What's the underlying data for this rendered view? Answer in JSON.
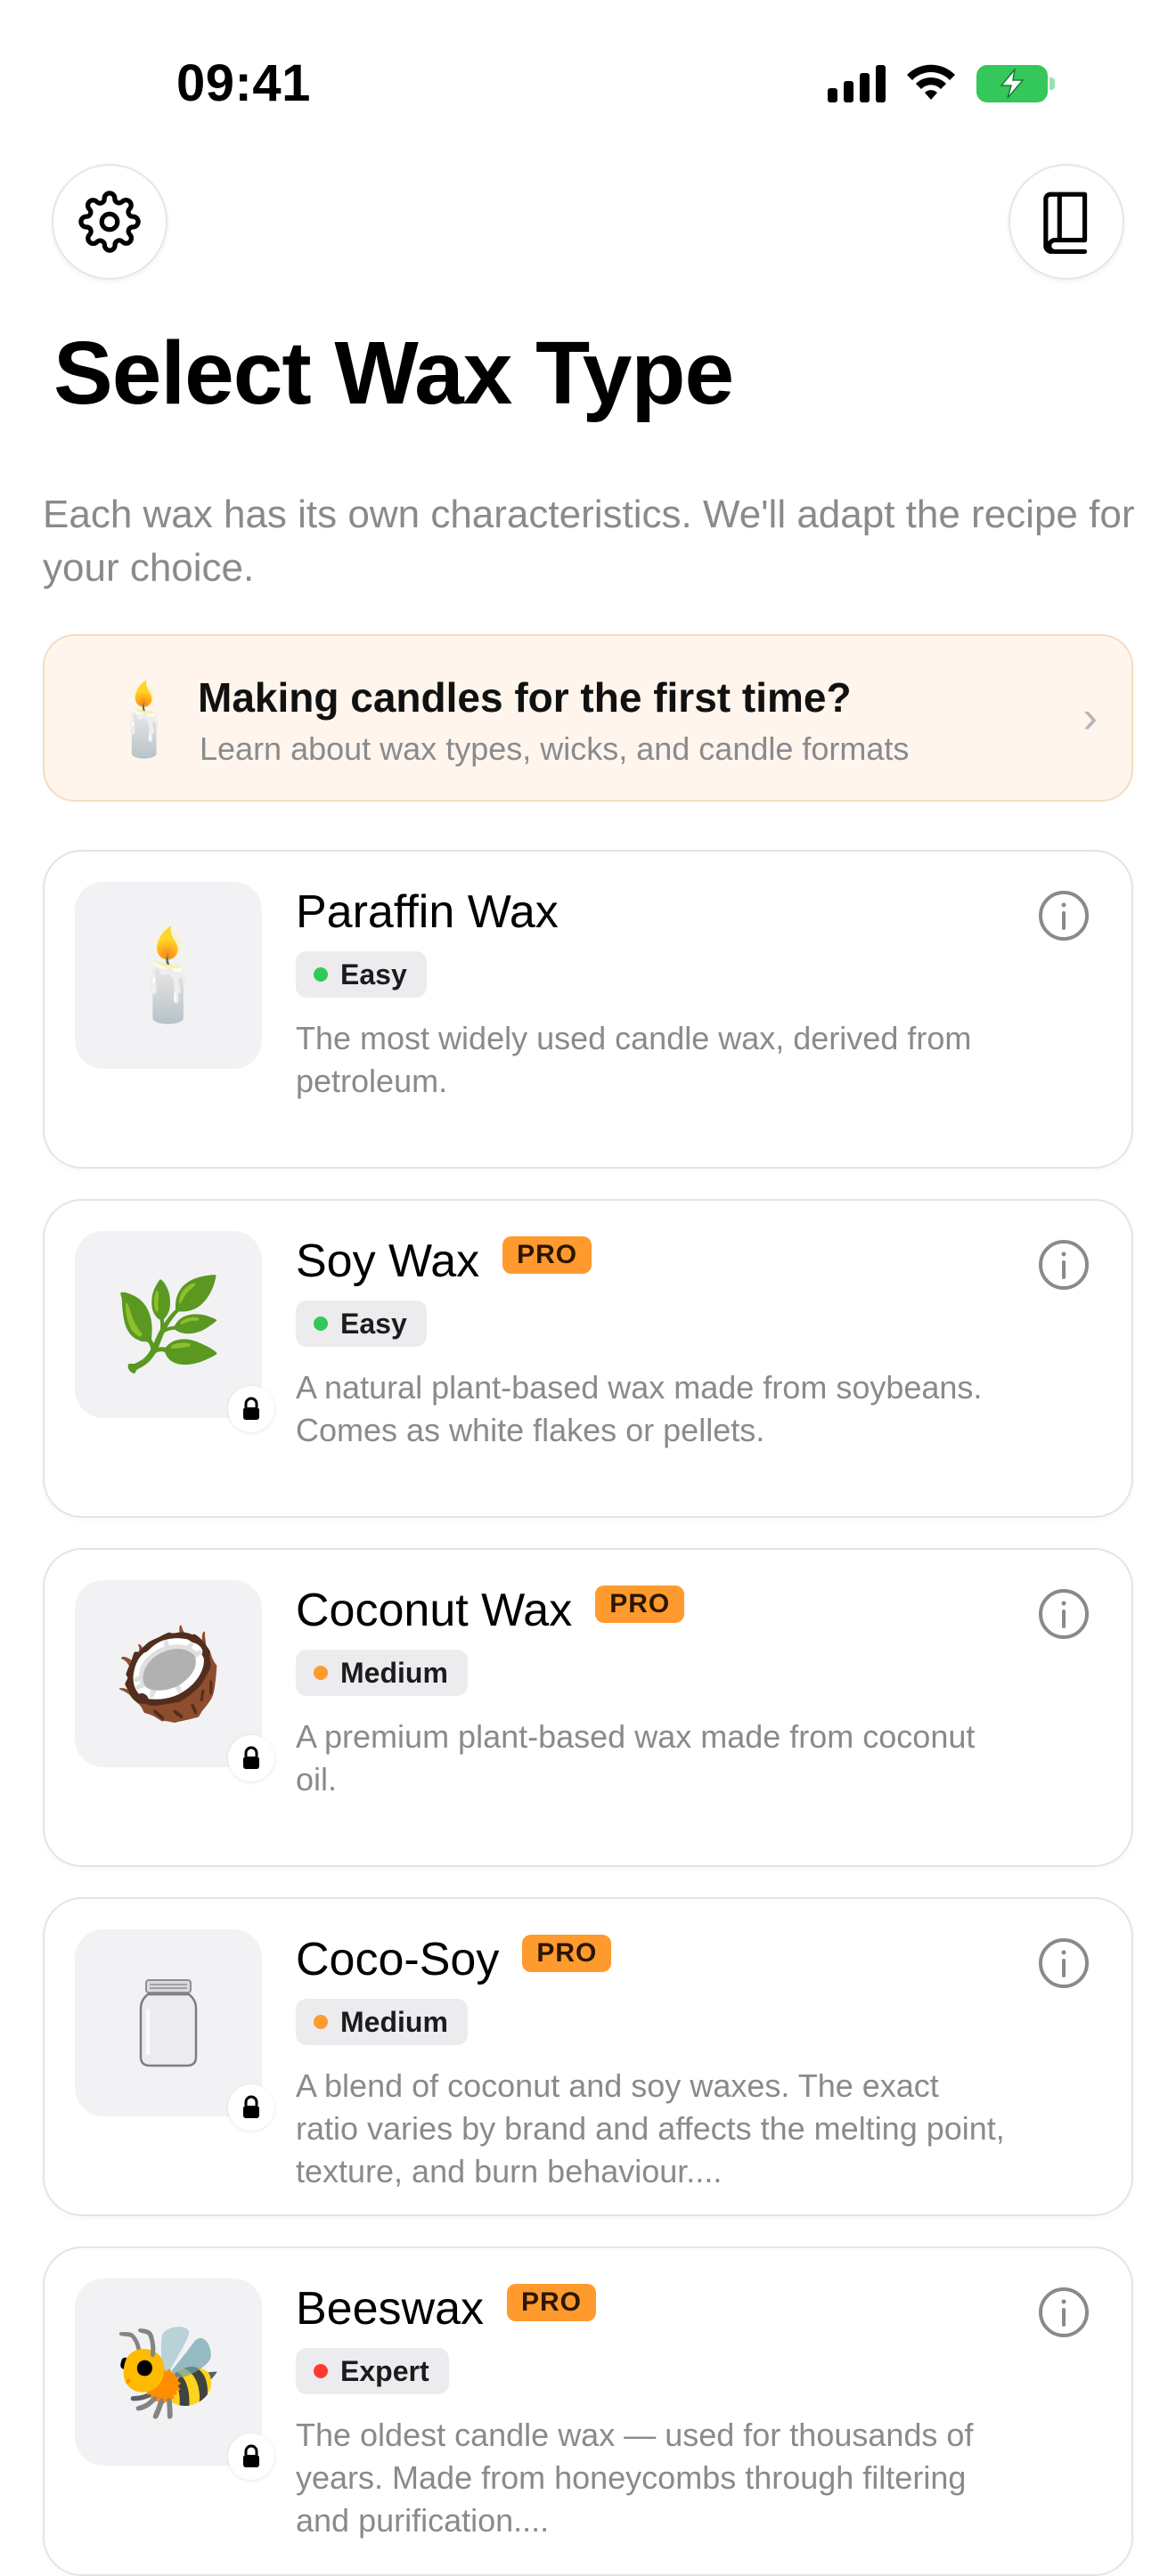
{
  "status_bar": {
    "time": "09:41"
  },
  "header": {
    "title": "Select Wax Type",
    "subtitle": "Each wax has its own characteristics. We'll adapt the recipe for your choice."
  },
  "banner": {
    "icon": "candle-emoji",
    "emoji": "🕯️",
    "title": "Making candles for the first time?",
    "subtitle": "Learn about wax types, wicks, and candle formats"
  },
  "colors": {
    "easy": "#34c759",
    "medium": "#ff9a2e",
    "expert": "#ff3b30",
    "pro_badge": "#ff9a2e",
    "banner_bg": "#fff5ec"
  },
  "wax_types": [
    {
      "name": "Paraffin Wax",
      "emoji": "🕯️",
      "pro": false,
      "pro_label": "",
      "locked": false,
      "level": "Easy",
      "level_color": "#34c759",
      "description": "The most widely used candle wax, derived from petroleum."
    },
    {
      "name": "Soy Wax",
      "emoji": "🌿",
      "pro": true,
      "pro_label": "PRO",
      "locked": true,
      "level": "Easy",
      "level_color": "#34c759",
      "description": "A natural plant-based wax made from soybeans. Comes as white flakes or pellets."
    },
    {
      "name": "Coconut Wax",
      "emoji": "🥥",
      "pro": true,
      "pro_label": "PRO",
      "locked": true,
      "level": "Medium",
      "level_color": "#ff9a2e",
      "description": "A premium plant-based wax made from coconut oil."
    },
    {
      "name": "Coco-Soy",
      "emoji": "🫙",
      "pro": true,
      "pro_label": "PRO",
      "locked": true,
      "level": "Medium",
      "level_color": "#ff9a2e",
      "description": "A blend of coconut and soy waxes. The exact ratio varies by brand and affects the melting point, texture, and burn behaviour...."
    },
    {
      "name": "Beeswax",
      "emoji": "🐝",
      "pro": true,
      "pro_label": "PRO",
      "locked": true,
      "level": "Expert",
      "level_color": "#ff3b30",
      "description": "The oldest candle wax — used for thousands of years. Made from honeycombs through filtering and purification...."
    }
  ]
}
